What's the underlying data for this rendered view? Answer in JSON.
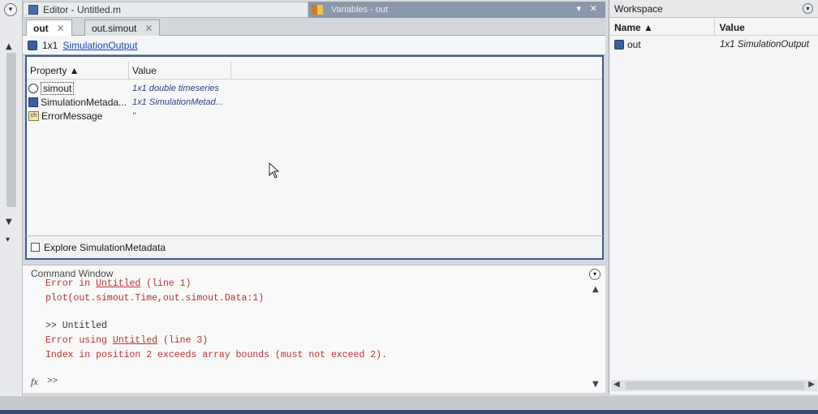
{
  "editor": {
    "title": "Editor - Untitled.m"
  },
  "variables": {
    "title": "Variables - out",
    "menu_glyph": "▾",
    "close_glyph": "✕"
  },
  "tabs": [
    {
      "label": "out",
      "close": "✕"
    },
    {
      "label": "out.simout",
      "close": "✕"
    }
  ],
  "var_header": {
    "size": "1x1",
    "class_link": "SimulationOutput"
  },
  "properties": {
    "columns": [
      "Property ▲",
      "Value"
    ],
    "rows": [
      {
        "name": "simout",
        "value": "1x1 double timeseries",
        "icon": "timeseries-icon"
      },
      {
        "name": "SimulationMetada...",
        "value": "1x1 SimulationMetad...",
        "icon": "object-icon"
      },
      {
        "name": "ErrorMessage",
        "value": "''",
        "icon": "char-array-icon"
      }
    ]
  },
  "explore": {
    "label": "Explore SimulationMetadata"
  },
  "command_window": {
    "title": "Command Window",
    "line1_prefix": "Error in ",
    "line1_link": "Untitled",
    "line1_suffix": " (line 1)",
    "line2": "plot(out.simout.Time,out.simout.Data:1)",
    "line3": ">> Untitled",
    "line4_prefix": "Error using ",
    "line4_link": "Untitled",
    "line4_suffix": " (line 3)",
    "line5": "Index in position 2 exceeds array bounds (must not exceed 2).",
    "prompt": ">>",
    "fx": "fx"
  },
  "workspace": {
    "title": "Workspace",
    "columns": [
      "Name ▲",
      "Value"
    ],
    "rows": [
      {
        "name": "out",
        "value": "1x1 SimulationOutput"
      }
    ]
  },
  "colors": {
    "accent": "#3a5d8c",
    "error": "#c03030",
    "link": "#1c45b5"
  }
}
